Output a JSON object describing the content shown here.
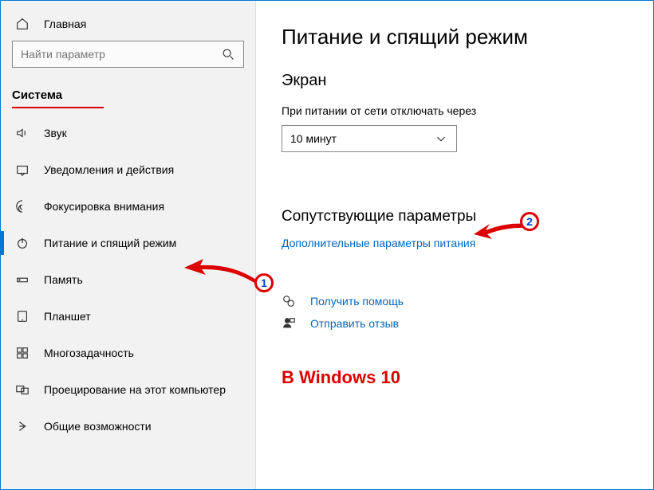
{
  "sidebar": {
    "home": "Главная",
    "search_placeholder": "Найти параметр",
    "category": "Система",
    "items": [
      {
        "label": "Звук",
        "icon": "sound-icon"
      },
      {
        "label": "Уведомления и действия",
        "icon": "notifications-icon"
      },
      {
        "label": "Фокусировка внимания",
        "icon": "focus-icon"
      },
      {
        "label": "Питание и спящий режим",
        "icon": "power-icon",
        "selected": true
      },
      {
        "label": "Память",
        "icon": "storage-icon"
      },
      {
        "label": "Планшет",
        "icon": "tablet-icon"
      },
      {
        "label": "Многозадачность",
        "icon": "multitask-icon"
      },
      {
        "label": "Проецирование на этот компьютер",
        "icon": "project-icon"
      },
      {
        "label": "Общие возможности",
        "icon": "shared-icon"
      }
    ]
  },
  "main": {
    "title": "Питание и спящий режим",
    "screen_heading": "Экран",
    "screen_label": "При питании от сети отключать через",
    "screen_value": "10 минут",
    "related_heading": "Сопутствующие параметры",
    "related_link": "Дополнительные параметры питания",
    "help_link": "Получить помощь",
    "feedback_link": "Отправить отзыв"
  },
  "annotations": {
    "badge1": "1",
    "badge2": "2",
    "caption": "В Windows 10"
  }
}
